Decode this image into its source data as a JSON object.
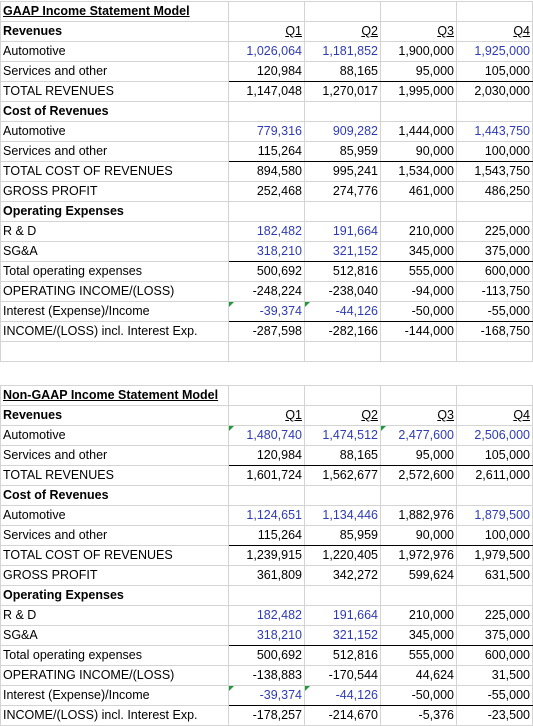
{
  "gaap": {
    "title": "GAAP Income Statement Model",
    "quarters": [
      "Q1",
      "Q2",
      "Q3",
      "Q4"
    ],
    "sections": [
      {
        "label": "Revenues",
        "kind": "section"
      },
      {
        "label": "Automotive",
        "kind": "row",
        "values": [
          "1,026,064",
          "1,181,852",
          "1,900,000",
          "1,925,000"
        ],
        "blue": [
          true,
          true,
          false,
          true
        ]
      },
      {
        "label": "Services and other",
        "kind": "row",
        "values": [
          "120,984",
          "88,165",
          "95,000",
          "105,000"
        ],
        "blue": [
          false,
          false,
          false,
          false
        ],
        "rule": true
      },
      {
        "label": "TOTAL REVENUES",
        "kind": "indent",
        "values": [
          "1,147,048",
          "1,270,017",
          "1,995,000",
          "2,030,000"
        ]
      },
      {
        "label": "Cost of Revenues",
        "kind": "section"
      },
      {
        "label": "Automotive",
        "kind": "row",
        "values": [
          "779,316",
          "909,282",
          "1,444,000",
          "1,443,750"
        ],
        "blue": [
          true,
          true,
          false,
          true
        ]
      },
      {
        "label": "Services and other",
        "kind": "row",
        "values": [
          "115,264",
          "85,959",
          "90,000",
          "100,000"
        ],
        "rule": true
      },
      {
        "label": "TOTAL COST OF REVENUES",
        "kind": "indent",
        "values": [
          "894,580",
          "995,241",
          "1,534,000",
          "1,543,750"
        ]
      },
      {
        "label": "GROSS PROFIT",
        "kind": "indent",
        "values": [
          "252,468",
          "274,776",
          "461,000",
          "486,250"
        ]
      },
      {
        "label": "Operating Expenses",
        "kind": "section"
      },
      {
        "label": "R & D",
        "kind": "row",
        "values": [
          "182,482",
          "191,664",
          "210,000",
          "225,000"
        ],
        "blue": [
          true,
          true,
          false,
          false
        ]
      },
      {
        "label": "SG&A",
        "kind": "row",
        "values": [
          "318,210",
          "321,152",
          "345,000",
          "375,000"
        ],
        "blue": [
          true,
          true,
          false,
          false
        ],
        "rule": true
      },
      {
        "label": "Total operating expenses",
        "kind": "indent",
        "values": [
          "500,692",
          "512,816",
          "555,000",
          "600,000"
        ]
      },
      {
        "label": "OPERATING INCOME/(LOSS)",
        "kind": "indent",
        "values": [
          "-248,224",
          "-238,040",
          "-94,000",
          "-113,750"
        ]
      },
      {
        "label": "Interest (Expense)/Income",
        "kind": "row",
        "values": [
          "-39,374",
          "-44,126",
          "-50,000",
          "-55,000"
        ],
        "blue": [
          true,
          true,
          false,
          false
        ],
        "rule": true,
        "tri": [
          true,
          true,
          false,
          false
        ]
      },
      {
        "label": "INCOME/(LOSS) incl. Interest Exp.",
        "kind": "indent",
        "values": [
          "-287,598",
          "-282,166",
          "-144,000",
          "-168,750"
        ]
      }
    ]
  },
  "nongaap": {
    "title": "Non-GAAP Income Statement Model",
    "quarters": [
      "Q1",
      "Q2",
      "Q3",
      "Q4"
    ],
    "sections": [
      {
        "label": "Revenues",
        "kind": "section"
      },
      {
        "label": "Automotive",
        "kind": "row",
        "values": [
          "1,480,740",
          "1,474,512",
          "2,477,600",
          "2,506,000"
        ],
        "blue": [
          true,
          true,
          true,
          true
        ],
        "tri": [
          true,
          false,
          true,
          false
        ]
      },
      {
        "label": "Services and other",
        "kind": "row",
        "values": [
          "120,984",
          "88,165",
          "95,000",
          "105,000"
        ],
        "rule": true
      },
      {
        "label": "TOTAL REVENUES",
        "kind": "indent",
        "values": [
          "1,601,724",
          "1,562,677",
          "2,572,600",
          "2,611,000"
        ]
      },
      {
        "label": "Cost of Revenues",
        "kind": "section"
      },
      {
        "label": "Automotive",
        "kind": "row",
        "values": [
          "1,124,651",
          "1,134,446",
          "1,882,976",
          "1,879,500"
        ],
        "blue": [
          true,
          true,
          false,
          true
        ]
      },
      {
        "label": "Services and other",
        "kind": "row",
        "values": [
          "115,264",
          "85,959",
          "90,000",
          "100,000"
        ],
        "rule": true
      },
      {
        "label": "TOTAL COST OF REVENUES",
        "kind": "indent",
        "values": [
          "1,239,915",
          "1,220,405",
          "1,972,976",
          "1,979,500"
        ]
      },
      {
        "label": "GROSS PROFIT",
        "kind": "indent",
        "values": [
          "361,809",
          "342,272",
          "599,624",
          "631,500"
        ]
      },
      {
        "label": "Operating Expenses",
        "kind": "section"
      },
      {
        "label": "R & D",
        "kind": "row",
        "values": [
          "182,482",
          "191,664",
          "210,000",
          "225,000"
        ],
        "blue": [
          true,
          true,
          false,
          false
        ]
      },
      {
        "label": "SG&A",
        "kind": "row",
        "values": [
          "318,210",
          "321,152",
          "345,000",
          "375,000"
        ],
        "blue": [
          true,
          true,
          false,
          false
        ],
        "rule": true
      },
      {
        "label": "Total operating expenses",
        "kind": "indent",
        "values": [
          "500,692",
          "512,816",
          "555,000",
          "600,000"
        ]
      },
      {
        "label": "OPERATING INCOME/(LOSS)",
        "kind": "indent",
        "values": [
          "-138,883",
          "-170,544",
          "44,624",
          "31,500"
        ]
      },
      {
        "label": "Interest (Expense)/Income",
        "kind": "row",
        "values": [
          "-39,374",
          "-44,126",
          "-50,000",
          "-55,000"
        ],
        "blue": [
          true,
          true,
          false,
          false
        ],
        "rule": true,
        "tri": [
          true,
          true,
          false,
          false
        ]
      },
      {
        "label": "INCOME/(LOSS) incl. Interest Exp.",
        "kind": "indent",
        "values": [
          "-178,257",
          "-214,670",
          "-5,376",
          "-23,500"
        ]
      }
    ]
  },
  "colors": {
    "input_blue": "#2f3bb5",
    "comment_green": "#1f9a3a",
    "gridline": "#d4d4d4"
  }
}
